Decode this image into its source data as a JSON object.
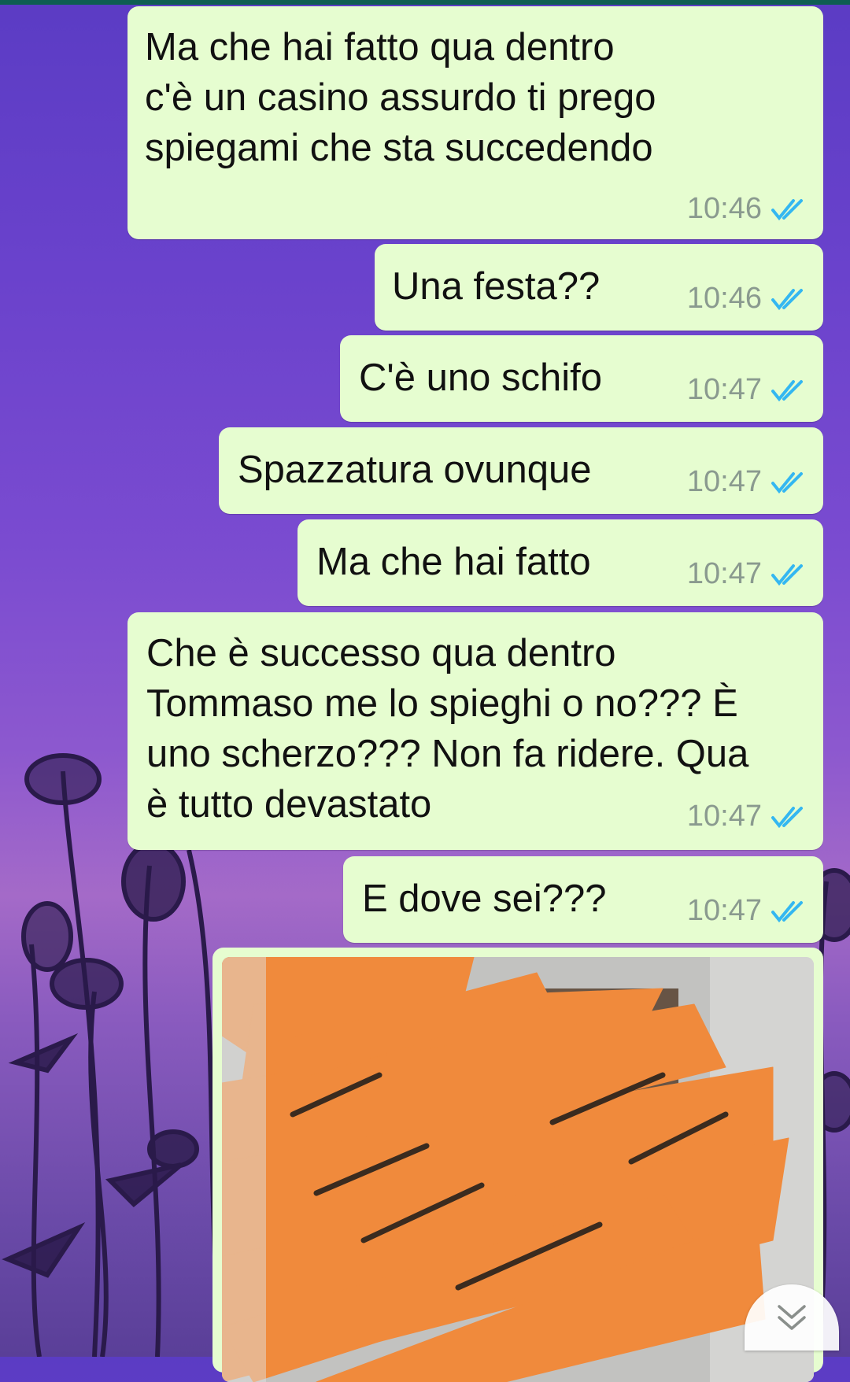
{
  "messages": [
    {
      "text": " Ma che hai fatto qua dentro\nc'è un casino assurdo ti prego\nspiegami che sta succedendo",
      "time": "10:46"
    },
    {
      "text": "Una festa??",
      "time": "10:46"
    },
    {
      "text": "C'è uno schifo",
      "time": "10:47"
    },
    {
      "text": "Spazzatura ovunque",
      "time": "10:47"
    },
    {
      "text": "Ma che hai fatto",
      "time": "10:47"
    },
    {
      "text": "Che è successo qua dentro\nTommaso me lo spieghi o no??? È\nuno scherzo??? Non fa ridere. Qua\nè tutto devastato",
      "time": "10:47"
    },
    {
      "text": "E dove sei???",
      "time": "10:47"
    }
  ],
  "icons": {
    "read_receipt": "double-check-icon",
    "scroll_down": "double-chevron-down-icon"
  },
  "colors": {
    "bubble": "#e6fdd0",
    "tick": "#34b7f1",
    "time": "#8a9a8f",
    "redaction": "#f08a3c"
  }
}
